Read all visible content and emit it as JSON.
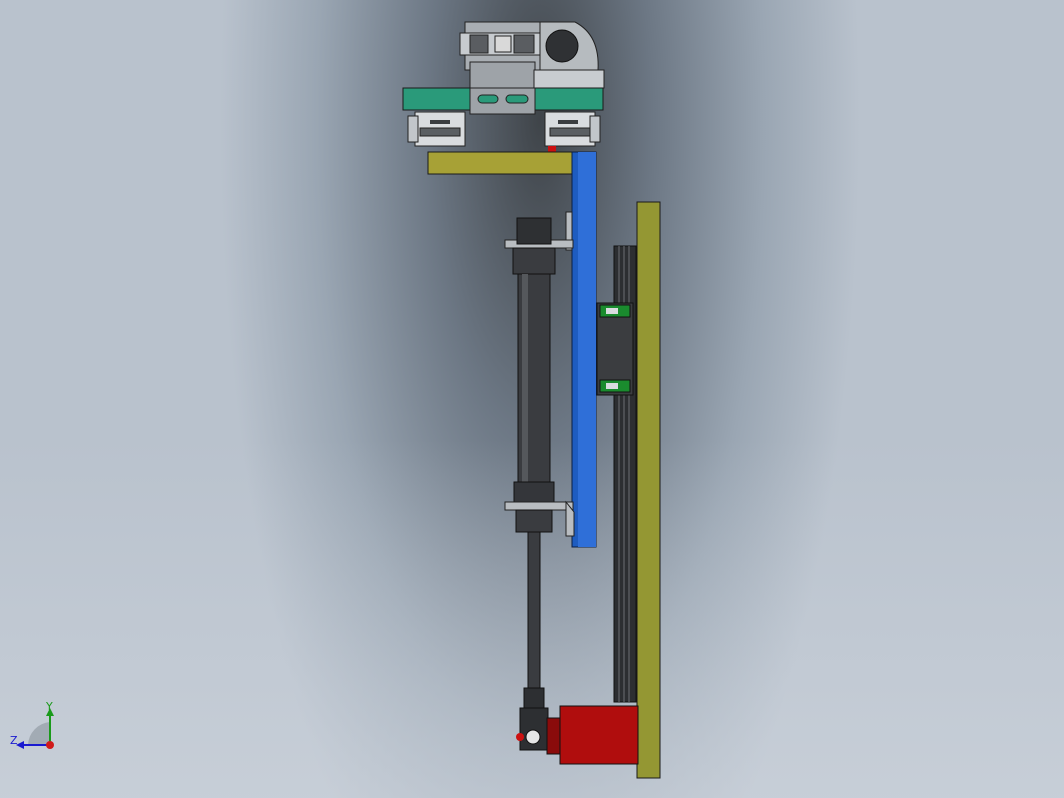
{
  "viewport": {
    "background_dark": "#3f4449",
    "background_light": "#b9c2cd"
  },
  "model": {
    "parts": [
      {
        "name": "mounting-bracket",
        "color": "#a9aeb3"
      },
      {
        "name": "base-plate",
        "color": "#2a9a7a"
      },
      {
        "name": "linear-guide-block-left",
        "color": "#d9dcdf"
      },
      {
        "name": "linear-guide-block-right",
        "color": "#d9dcdf"
      },
      {
        "name": "top-slide-plate",
        "color": "#a7a136"
      },
      {
        "name": "blue-vertical-plate",
        "color": "#1e5cc0"
      },
      {
        "name": "yellow-vertical-plate",
        "color": "#949733"
      },
      {
        "name": "pneumatic-cylinder",
        "color": "#3a3c40"
      },
      {
        "name": "piston-rod",
        "color": "#3a3c40"
      },
      {
        "name": "rod-end-clevis",
        "color": "#2d2f32"
      },
      {
        "name": "red-stopper-block",
        "color": "#b00d0d"
      },
      {
        "name": "slide-carriage",
        "color": "#3b3d40"
      },
      {
        "name": "carriage-green-seal",
        "color": "#1a8b2e"
      },
      {
        "name": "vertical-rail",
        "color": "#2c2e31"
      }
    ]
  },
  "triad": {
    "y_label": "Y",
    "z_label": "Z",
    "y_color": "#1a9a1a",
    "z_color": "#1a1ad0",
    "x_color": "#d01a1a"
  }
}
